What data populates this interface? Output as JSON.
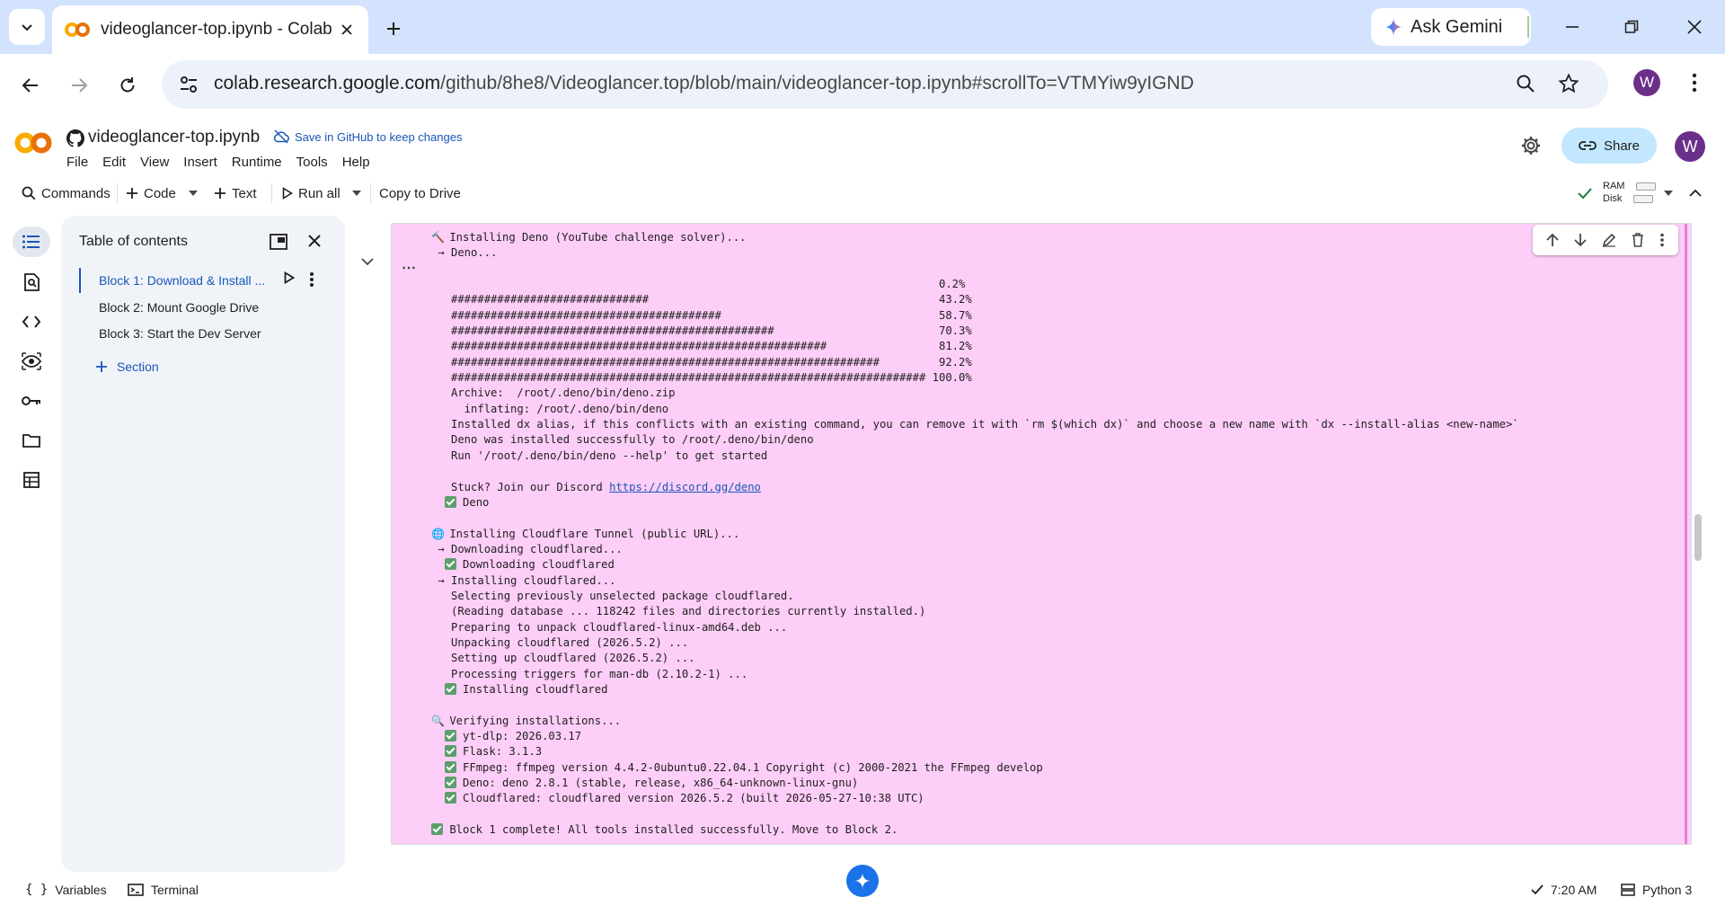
{
  "browser": {
    "tab_title": "videoglancer-top.ipynb - Colab",
    "ask_gemini": "Ask Gemini",
    "url_host": "colab.research.google.com",
    "url_path": "/github/8he8/Videoglancer.top/blob/main/videoglancer-top.ipynb#scrollTo=VTMYiw9yIGND",
    "profile_initial": "W"
  },
  "colab": {
    "notebook_title": "videoglancer-top.ipynb",
    "save_github": "Save in GitHub to keep changes",
    "menu": [
      "File",
      "Edit",
      "View",
      "Insert",
      "Runtime",
      "Tools",
      "Help"
    ],
    "share_label": "Share",
    "profile_initial": "W"
  },
  "toolbar": {
    "commands": "Commands",
    "code": "Code",
    "text": "Text",
    "run_all": "Run all",
    "copy_to_drive": "Copy to Drive",
    "ram": "RAM",
    "disk": "Disk"
  },
  "toc": {
    "title": "Table of contents",
    "items": [
      "Block 1: Download & Install ...",
      "Block 2: Mount Google Drive",
      "Block 3: Start the Dev Server"
    ],
    "add_section": "Section"
  },
  "output_lines": [
    {
      "icon": "hammer",
      "text": "Installing Deno (YouTube challenge solver)..."
    },
    {
      "icon": "",
      "text": " → Deno..."
    },
    {
      "icon": "",
      "text": ""
    },
    {
      "icon": "",
      "text": "                                                                             0.2%"
    },
    {
      "icon": "",
      "text": "   ##############################                                            43.2%"
    },
    {
      "icon": "",
      "text": "   #########################################                                 58.7%"
    },
    {
      "icon": "",
      "text": "   #################################################                         70.3%"
    },
    {
      "icon": "",
      "text": "   #########################################################                 81.2%"
    },
    {
      "icon": "",
      "text": "   #################################################################         92.2%"
    },
    {
      "icon": "",
      "text": "   ######################################################################## 100.0%"
    },
    {
      "icon": "",
      "text": "   Archive:  /root/.deno/bin/deno.zip"
    },
    {
      "icon": "",
      "text": "     inflating: /root/.deno/bin/deno"
    },
    {
      "icon": "",
      "text": "   Installed dx alias, if this conflicts with an existing command, you can remove it with `rm $(which dx)` and choose a new name with `dx --install-alias <new-name>`"
    },
    {
      "icon": "",
      "text": "   Deno was installed successfully to /root/.deno/bin/deno"
    },
    {
      "icon": "",
      "text": "   Run '/root/.deno/bin/deno --help' to get started"
    },
    {
      "icon": "",
      "text": ""
    },
    {
      "icon": "",
      "text": "   Stuck? Join our Discord ",
      "link": "https://discord.gg/deno"
    },
    {
      "icon": "check",
      "indent": true,
      "text": "Deno"
    },
    {
      "icon": "",
      "text": ""
    },
    {
      "icon": "globe",
      "text": "Installing Cloudflare Tunnel (public URL)..."
    },
    {
      "icon": "",
      "text": " → Downloading cloudflared..."
    },
    {
      "icon": "check",
      "indent": true,
      "text": "Downloading cloudflared"
    },
    {
      "icon": "",
      "text": " → Installing cloudflared..."
    },
    {
      "icon": "",
      "text": "   Selecting previously unselected package cloudflared."
    },
    {
      "icon": "",
      "text": "   (Reading database ... 118242 files and directories currently installed.)"
    },
    {
      "icon": "",
      "text": "   Preparing to unpack cloudflared-linux-amd64.deb ..."
    },
    {
      "icon": "",
      "text": "   Unpacking cloudflared (2026.5.2) ..."
    },
    {
      "icon": "",
      "text": "   Setting up cloudflared (2026.5.2) ..."
    },
    {
      "icon": "",
      "text": "   Processing triggers for man-db (2.10.2-1) ..."
    },
    {
      "icon": "check",
      "indent": true,
      "text": "Installing cloudflared"
    },
    {
      "icon": "",
      "text": ""
    },
    {
      "icon": "magnifier",
      "text": "Verifying installations..."
    },
    {
      "icon": "check",
      "indent": true,
      "text": "yt-dlp: 2026.03.17"
    },
    {
      "icon": "check",
      "indent": true,
      "text": "Flask: 3.1.3"
    },
    {
      "icon": "check",
      "indent": true,
      "text": "FFmpeg: ffmpeg version 4.4.2-0ubuntu0.22.04.1 Copyright (c) 2000-2021 the FFmpeg develop"
    },
    {
      "icon": "check",
      "indent": true,
      "text": "Deno: deno 2.8.1 (stable, release, x86_64-unknown-linux-gnu)"
    },
    {
      "icon": "check",
      "indent": true,
      "text": "Cloudflared: cloudflared version 2026.5.2 (built 2026-05-27-10:38 UTC)"
    },
    {
      "icon": "",
      "text": ""
    },
    {
      "icon": "check",
      "text": "Block 1 complete! All tools installed successfully. Move to Block 2."
    }
  ],
  "statusbar": {
    "variables": "Variables",
    "terminal": "Terminal",
    "time": "7:20 AM",
    "runtime": "Python 3"
  }
}
